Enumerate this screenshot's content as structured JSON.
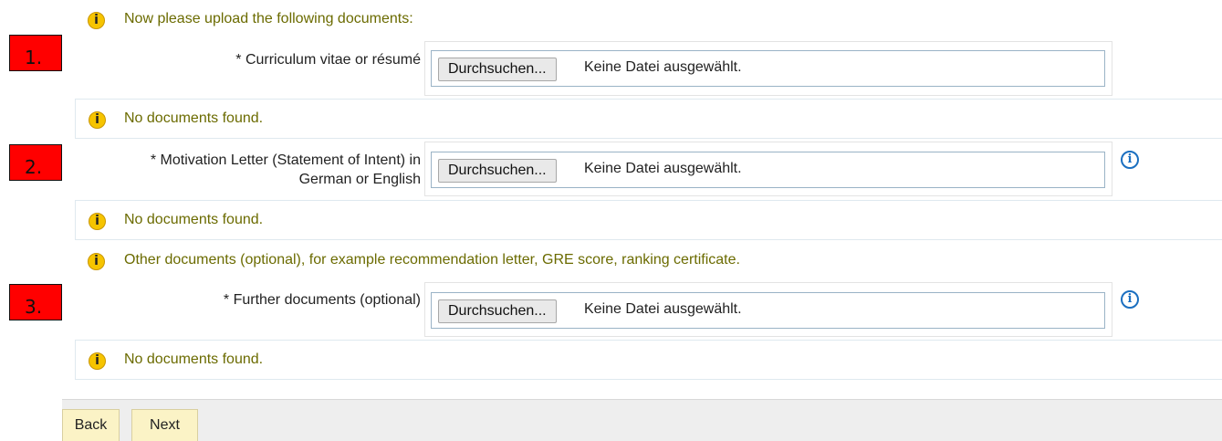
{
  "markers": [
    "1.",
    "2.",
    "3."
  ],
  "intro_text": "Now please upload the following documents:",
  "other_docs_text": "Other documents (optional), for example recommendation letter, GRE score, ranking certificate.",
  "no_docs_text": "No documents found.",
  "uploads": [
    {
      "label": "* Curriculum vitae or résumé",
      "button": "Durchsuchen...",
      "status": "Keine Datei ausgewählt.",
      "has_help": false
    },
    {
      "label_line1": "* Motivation Letter (Statement of Intent) in",
      "label_line2": "German or English",
      "button": "Durchsuchen...",
      "status": "Keine Datei ausgewählt.",
      "has_help": true
    },
    {
      "label": "* Further documents (optional)",
      "button": "Durchsuchen...",
      "status": "Keine Datei ausgewählt.",
      "has_help": true
    }
  ],
  "footer": {
    "back_label": "Back",
    "next_label": "Next"
  },
  "icons": {
    "info": "info-warning-icon",
    "help": "help-info-icon"
  },
  "colors": {
    "marker": "#ff0000",
    "info_text": "#6b6b00",
    "help_icon": "#1b6fc0",
    "nav_button": "#fbf3c6"
  }
}
